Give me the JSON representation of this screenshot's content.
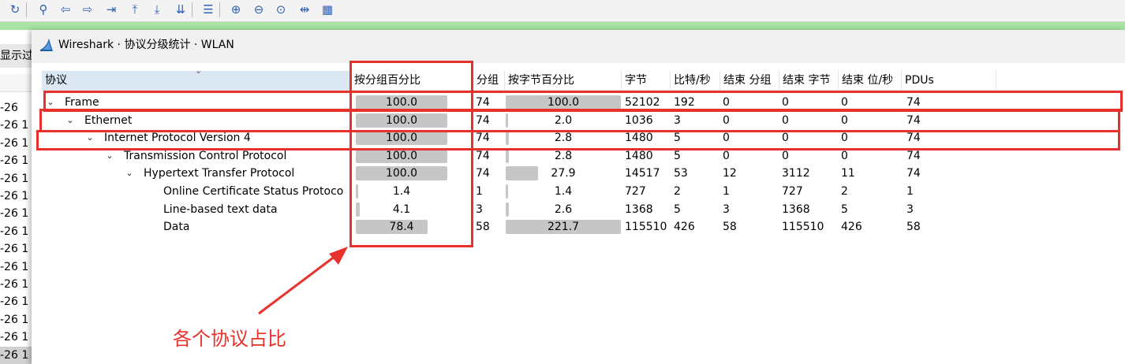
{
  "toolbar": {
    "buttons": [
      "reload-icon",
      "find-icon",
      "go-back-icon",
      "go-forward-icon",
      "go-to-packet-icon",
      "first-packet-icon",
      "last-packet-icon",
      "autoscroll-icon",
      "colorize-icon",
      "zoom-in-icon",
      "zoom-out-icon",
      "normal-size-icon",
      "resize-columns-icon",
      "grid-icon"
    ],
    "colors": {
      "accent": "#2f5fb0",
      "green_bar": "#a7e3a2"
    }
  },
  "background": {
    "filter_label": "显示过",
    "rows": [
      "-26",
      "-26  1",
      "-26  1",
      "-26  1",
      "-26  1",
      "-26  1",
      "-26  1",
      "-26  1",
      "-26  1",
      "-26  1",
      "-26  1",
      "-26  1",
      "-26  1",
      "-26  1",
      "-26  1"
    ]
  },
  "window": {
    "title": "Wireshark · 协议分级统计 · WLAN"
  },
  "table": {
    "columns": [
      "协议",
      "按分组百分比",
      "分组",
      "按字节百分比",
      "字节",
      "比特/秒",
      "结束 分组",
      "结束 字节",
      "结束 位/秒",
      "PDUs"
    ],
    "rows": [
      {
        "protocol": "Frame",
        "depth": 0,
        "expanded": true,
        "pct_packets": "100.0",
        "pct_packets_value": 100.0,
        "packets": "74",
        "pct_bytes": "100.0",
        "pct_bytes_value": 100.0,
        "bytes": "52102",
        "bits_per_sec": "192",
        "end_packets": "0",
        "end_bytes": "0",
        "end_bits_per_sec": "0",
        "pdus": "74"
      },
      {
        "protocol": "Ethernet",
        "depth": 1,
        "expanded": true,
        "pct_packets": "100.0",
        "pct_packets_value": 100.0,
        "packets": "74",
        "pct_bytes": "2.0",
        "pct_bytes_value": 2.0,
        "bytes": "1036",
        "bits_per_sec": "3",
        "end_packets": "0",
        "end_bytes": "0",
        "end_bits_per_sec": "0",
        "pdus": "74"
      },
      {
        "protocol": "Internet Protocol Version 4",
        "depth": 2,
        "expanded": true,
        "pct_packets": "100.0",
        "pct_packets_value": 100.0,
        "packets": "74",
        "pct_bytes": "2.8",
        "pct_bytes_value": 2.8,
        "bytes": "1480",
        "bits_per_sec": "5",
        "end_packets": "0",
        "end_bytes": "0",
        "end_bits_per_sec": "0",
        "pdus": "74"
      },
      {
        "protocol": "Transmission Control Protocol",
        "depth": 3,
        "expanded": true,
        "pct_packets": "100.0",
        "pct_packets_value": 100.0,
        "packets": "74",
        "pct_bytes": "2.8",
        "pct_bytes_value": 2.8,
        "bytes": "1480",
        "bits_per_sec": "5",
        "end_packets": "0",
        "end_bytes": "0",
        "end_bits_per_sec": "0",
        "pdus": "74"
      },
      {
        "protocol": "Hypertext Transfer Protocol",
        "depth": 4,
        "expanded": true,
        "pct_packets": "100.0",
        "pct_packets_value": 100.0,
        "packets": "74",
        "pct_bytes": "27.9",
        "pct_bytes_value": 27.9,
        "bytes": "14517",
        "bits_per_sec": "53",
        "end_packets": "12",
        "end_bytes": "3112",
        "end_bits_per_sec": "11",
        "pdus": "74"
      },
      {
        "protocol": "Online Certificate Status Protoco",
        "depth": 5,
        "expanded": false,
        "pct_packets": "1.4",
        "pct_packets_value": 1.4,
        "packets": "1",
        "pct_bytes": "1.4",
        "pct_bytes_value": 1.4,
        "bytes": "727",
        "bits_per_sec": "2",
        "end_packets": "1",
        "end_bytes": "727",
        "end_bits_per_sec": "2",
        "pdus": "1"
      },
      {
        "protocol": "Line-based text data",
        "depth": 5,
        "expanded": false,
        "pct_packets": "4.1",
        "pct_packets_value": 4.1,
        "packets": "3",
        "pct_bytes": "2.6",
        "pct_bytes_value": 2.6,
        "bytes": "1368",
        "bits_per_sec": "5",
        "end_packets": "3",
        "end_bytes": "1368",
        "end_bits_per_sec": "5",
        "pdus": "3"
      },
      {
        "protocol": "Data",
        "depth": 5,
        "expanded": false,
        "pct_packets": "78.4",
        "pct_packets_value": 78.4,
        "packets": "58",
        "pct_bytes": "221.7",
        "pct_bytes_value": 221.7,
        "bytes": "115510",
        "bits_per_sec": "426",
        "end_packets": "58",
        "end_bytes": "115510",
        "end_bits_per_sec": "426",
        "pdus": "58"
      }
    ]
  },
  "annotation": {
    "text": "各个协议占比",
    "color": "#e8312a"
  }
}
